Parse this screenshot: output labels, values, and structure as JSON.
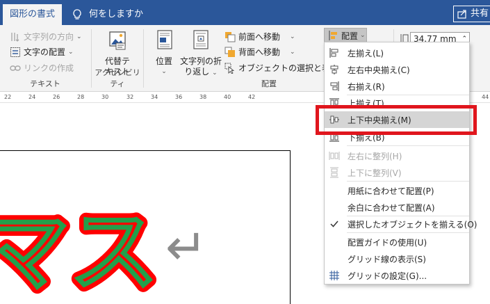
{
  "tabs": {
    "active": "図形の書式",
    "tell_me": "何をしますか",
    "share": "共有"
  },
  "ribbon": {
    "text_group": {
      "label": "テキスト",
      "text_direction": "文字列の方向",
      "text_align": "文字の配置",
      "create_link": "リンクの作成"
    },
    "accessibility_group": {
      "label": "アクセシビリティ",
      "alt_text_line1": "代替テ",
      "alt_text_line2": "キスト"
    },
    "arrange_group": {
      "label": "配置",
      "position": "位置",
      "wrap_text_line1": "文字列の折",
      "wrap_text_line2": "り返し",
      "bring_forward": "前面へ移動",
      "send_backward": "背面へ移動",
      "selection_pane": "オブジェクトの選択と表示",
      "align_button": "配置"
    },
    "size": {
      "height_value": "34.77 mm"
    }
  },
  "ruler": [
    "22",
    "24",
    "26",
    "28",
    "30",
    "32",
    "34",
    "36",
    "38",
    "40",
    "42",
    "44"
  ],
  "document": {
    "wordart_text": "マス",
    "return_mark": "↵"
  },
  "align_menu": {
    "items": [
      {
        "label": "左揃え(L)",
        "icon": "align-left-icon",
        "disabled": false
      },
      {
        "label": "左右中央揃え(C)",
        "icon": "align-center-icon",
        "disabled": false
      },
      {
        "label": "右揃え(R)",
        "icon": "align-right-icon",
        "disabled": false
      },
      {
        "label": "上揃え(T)",
        "icon": "align-top-icon",
        "disabled": false
      },
      {
        "label": "上下中央揃え(M)",
        "icon": "align-middle-icon",
        "disabled": false,
        "highlighted": true
      },
      {
        "label": "下揃え(B)",
        "icon": "align-bottom-icon",
        "disabled": false
      },
      {
        "label": "左右に整列(H)",
        "icon": "distribute-horizontal-icon",
        "disabled": true
      },
      {
        "label": "上下に整列(V)",
        "icon": "distribute-vertical-icon",
        "disabled": true
      },
      {
        "label": "用紙に合わせて配置(P)",
        "icon": "",
        "disabled": false
      },
      {
        "label": "余白に合わせて配置(A)",
        "icon": "",
        "disabled": false
      },
      {
        "label": "選択したオブジェクトを揃える(O)",
        "icon": "checkmark-icon",
        "disabled": false
      },
      {
        "label": "配置ガイドの使用(U)",
        "icon": "",
        "disabled": false
      },
      {
        "label": "グリッド線の表示(S)",
        "icon": "",
        "disabled": false
      },
      {
        "label": "グリッドの設定(G)...",
        "icon": "grid-icon",
        "disabled": false
      }
    ]
  },
  "colors": {
    "accent": "#2b579a",
    "highlight_border": "#e0161d",
    "wordart_fill": "#ff0000",
    "wordart_inner": "#22a04b"
  }
}
